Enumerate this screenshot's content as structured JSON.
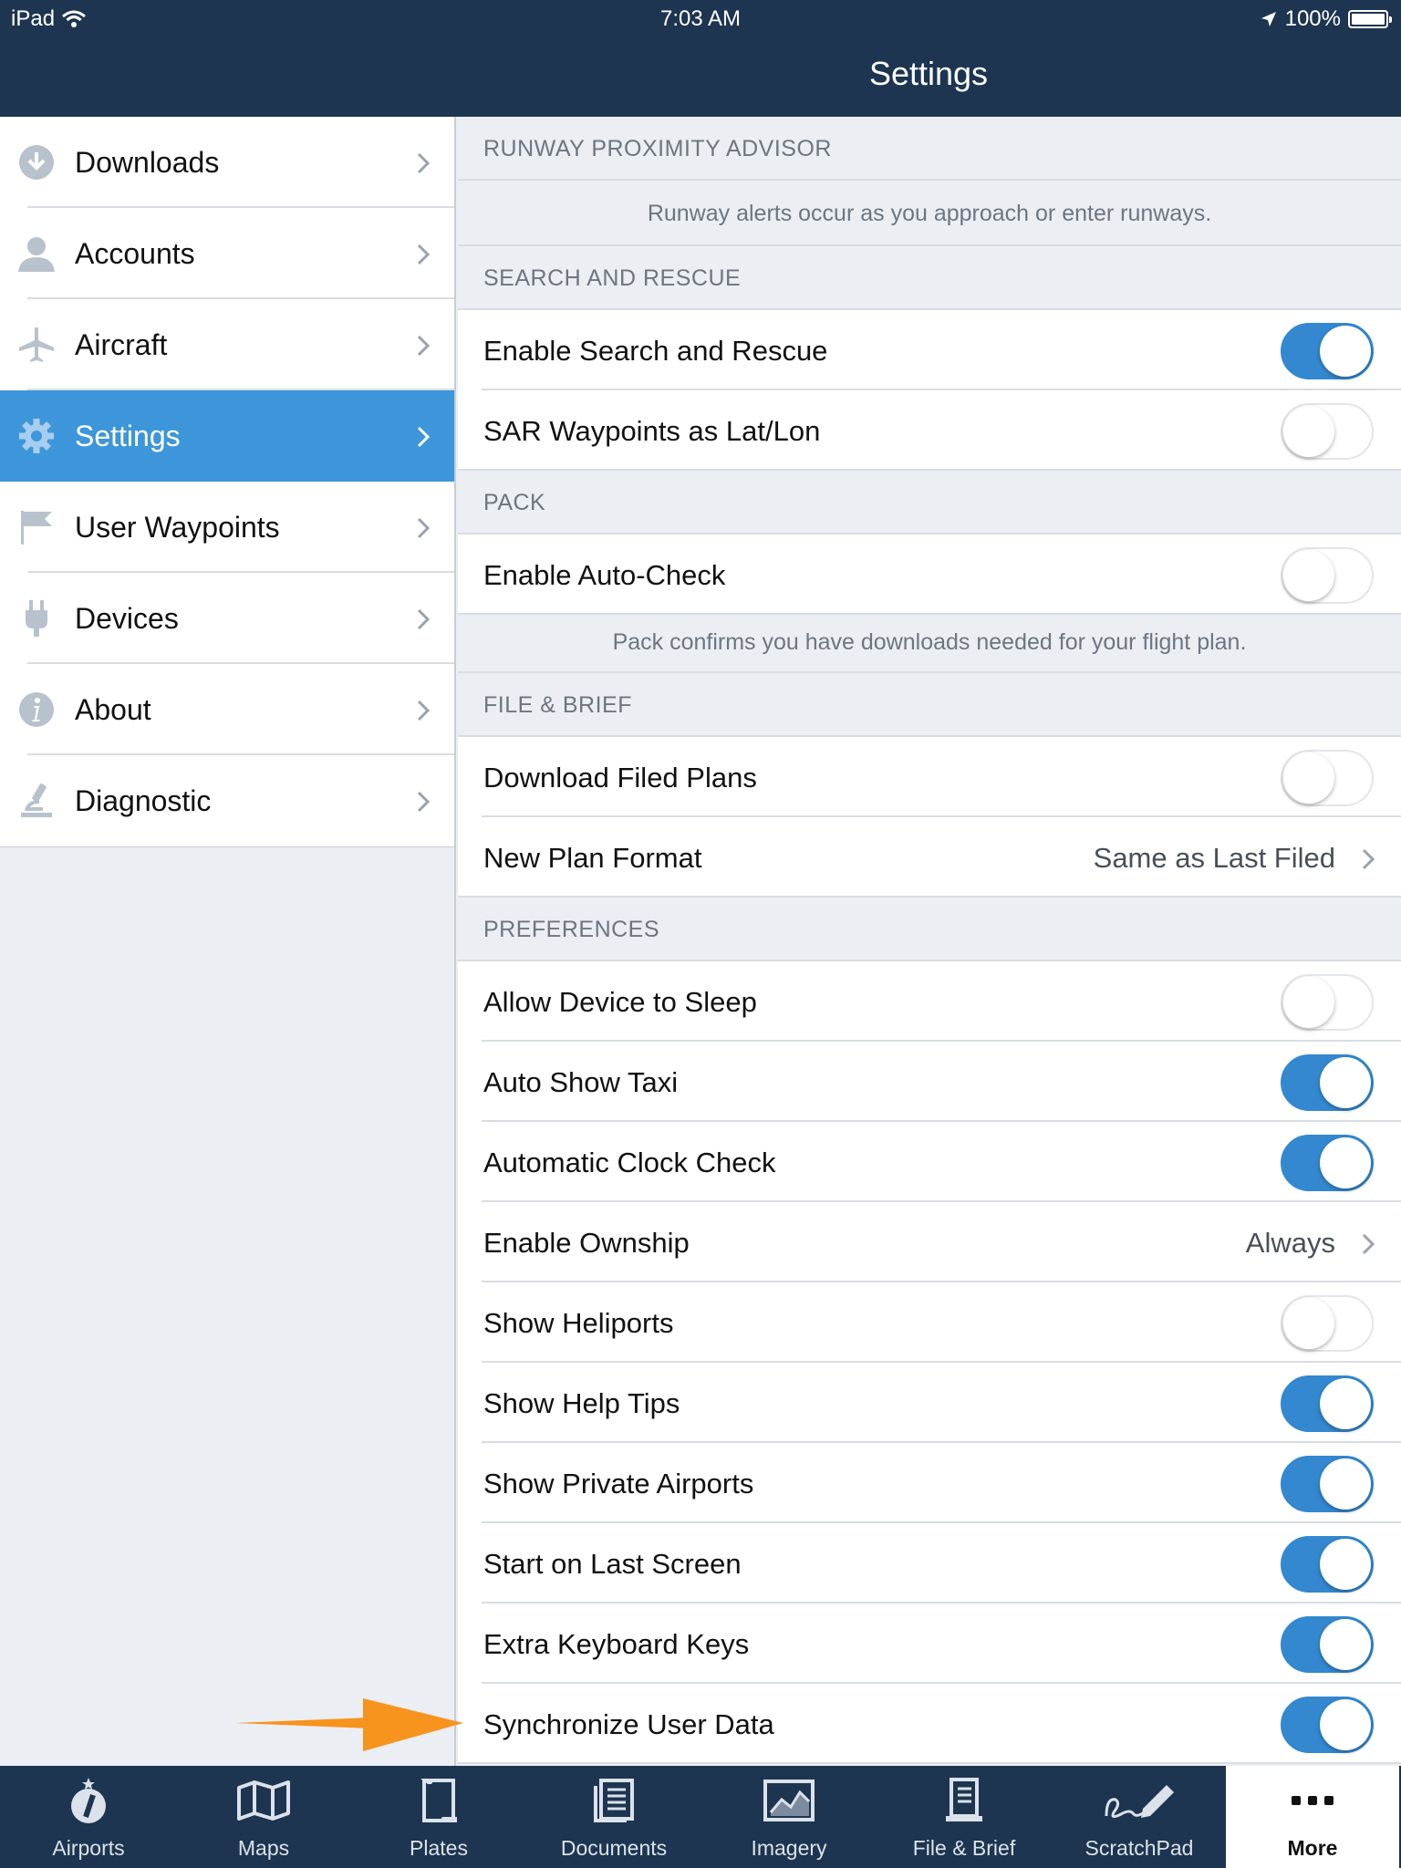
{
  "status_bar": {
    "device": "iPad",
    "time": "7:03 AM",
    "battery": "100%"
  },
  "header": {
    "title": "Settings"
  },
  "sidebar": {
    "items": [
      {
        "label": "Downloads",
        "icon": "download-icon"
      },
      {
        "label": "Accounts",
        "icon": "person-icon"
      },
      {
        "label": "Aircraft",
        "icon": "airplane-icon"
      },
      {
        "label": "Settings",
        "icon": "gear-icon",
        "active": true
      },
      {
        "label": "User Waypoints",
        "icon": "flag-icon"
      },
      {
        "label": "Devices",
        "icon": "plug-icon"
      },
      {
        "label": "About",
        "icon": "info-icon"
      },
      {
        "label": "Diagnostic",
        "icon": "microscope-icon"
      }
    ]
  },
  "sections": {
    "runway": {
      "header": "RUNWAY PROXIMITY ADVISOR",
      "footer": "Runway alerts occur as you approach or enter runways."
    },
    "sar": {
      "header": "SEARCH AND RESCUE",
      "rows": [
        {
          "label": "Enable Search and Rescue",
          "on": true
        },
        {
          "label": "SAR Waypoints as Lat/Lon",
          "on": false
        }
      ]
    },
    "pack": {
      "header": "PACK",
      "rows": [
        {
          "label": "Enable Auto-Check",
          "on": false
        }
      ],
      "footer": "Pack confirms you have downloads needed for your flight plan."
    },
    "file_brief": {
      "header": "FILE & BRIEF",
      "rows": [
        {
          "label": "Download Filed Plans",
          "on": false
        },
        {
          "label": "New Plan Format",
          "value": "Same as Last Filed"
        }
      ]
    },
    "preferences": {
      "header": "PREFERENCES",
      "rows": [
        {
          "label": "Allow Device to Sleep",
          "on": false
        },
        {
          "label": "Auto Show Taxi",
          "on": true
        },
        {
          "label": "Automatic Clock Check",
          "on": true
        },
        {
          "label": "Enable Ownship",
          "value": "Always"
        },
        {
          "label": "Show Heliports",
          "on": false
        },
        {
          "label": "Show Help Tips",
          "on": true
        },
        {
          "label": "Show Private Airports",
          "on": true
        },
        {
          "label": "Start on Last Screen",
          "on": true
        },
        {
          "label": "Extra Keyboard Keys",
          "on": true
        },
        {
          "label": "Synchronize User Data",
          "on": true
        }
      ]
    }
  },
  "tabbar": {
    "tabs": [
      {
        "label": "Airports",
        "icon": "airport-compass-icon"
      },
      {
        "label": "Maps",
        "icon": "map-icon"
      },
      {
        "label": "Plates",
        "icon": "plates-icon"
      },
      {
        "label": "Documents",
        "icon": "documents-icon"
      },
      {
        "label": "Imagery",
        "icon": "imagery-icon"
      },
      {
        "label": "File & Brief",
        "icon": "clipboard-icon"
      },
      {
        "label": "ScratchPad",
        "icon": "pen-icon"
      },
      {
        "label": "More",
        "icon": "more-dots-icon",
        "active": true
      }
    ]
  },
  "colors": {
    "nav_bg": "#1d3550",
    "accent": "#3d96d9",
    "toggle_on": "#3388d0",
    "annotation_arrow": "#f7941d"
  }
}
